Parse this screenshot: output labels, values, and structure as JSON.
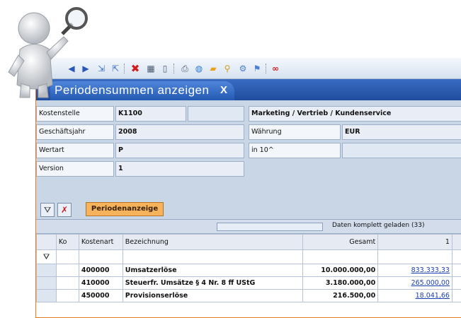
{
  "toolbar": {
    "icons": [
      "nav-back-icon",
      "nav-forward-icon",
      "export-icon",
      "import-icon",
      "delete-icon",
      "calculator-icon",
      "new-doc-icon",
      "print-icon",
      "globe-icon",
      "folder-icon",
      "pin-icon",
      "settings-icon",
      "help-icon",
      "link-icon"
    ]
  },
  "window": {
    "tab_title": "Periodensummen anzeigen",
    "tab_close": "X"
  },
  "form": {
    "kostenstelle_label": "Kostenstelle",
    "kostenstelle_value": "K1100",
    "kostenstelle_desc": "Marketing / Vertrieb / Kundenservice",
    "geschaeftsjahr_label": "Geschäftsjahr",
    "geschaeftsjahr_value": "2008",
    "waehrung_label": "Währung",
    "waehrung_value": "EUR",
    "wertart_label": "Wertart",
    "wertart_value": "P",
    "in10_label": "in 10^",
    "version_label": "Version",
    "version_value": "1"
  },
  "filterbar": {
    "period_button": "Periodenanzeige"
  },
  "grid": {
    "status": "Daten komplett geladen (33)",
    "columns": [
      "Ko",
      "Kostenart",
      "Bezeichnung",
      "Gesamt",
      "1"
    ],
    "rows": [
      {
        "kostenart": "400000",
        "bezeichnung": "Umsatzerlöse",
        "gesamt": "10.000.000,00",
        "p1": "833.333,33"
      },
      {
        "kostenart": "410000",
        "bezeichnung": "Steuerfr. Umsätze § 4 Nr. 8 ff UStG",
        "gesamt": "3.180.000,00",
        "p1": "265.000,00"
      },
      {
        "kostenart": "450000",
        "bezeichnung": "Provisionserlöse",
        "gesamt": "216.500,00",
        "p1": "18.041,66"
      }
    ]
  }
}
